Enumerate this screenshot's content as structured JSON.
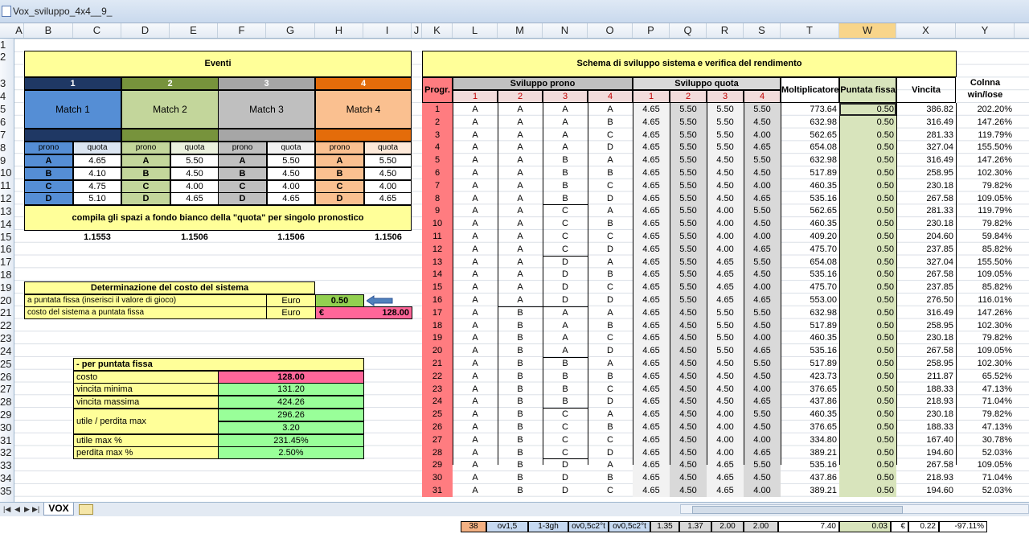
{
  "window": {
    "title": "Vox_sviluppo_4x4__9_"
  },
  "colors": {
    "navy": "#1f3864",
    "olive": "#77933c",
    "grey": "#a6a6a6",
    "orange": "#e46c0a",
    "yellow": "#ffff99",
    "green": "#92d050",
    "lightgreen": "#99ff99",
    "pink": "#ff6699",
    "salmon": "#ff7c80",
    "blue": "#558ed5",
    "teal": "#d8e4bc",
    "lilac": "#d9d9f3"
  },
  "columns": [
    "A",
    "B",
    "C",
    "D",
    "E",
    "F",
    "G",
    "H",
    "I",
    "J",
    "K",
    "L",
    "M",
    "N",
    "O",
    "P",
    "Q",
    "R",
    "S",
    "T",
    "W",
    "X",
    "Y"
  ],
  "rows": [
    "1",
    "2",
    "3",
    "4",
    "5",
    "6",
    "7",
    "8",
    "9",
    "10",
    "11",
    "12",
    "13",
    "14",
    "15",
    "16",
    "17",
    "18",
    "19",
    "20",
    "21",
    "22",
    "23",
    "24",
    "25",
    "26",
    "27",
    "28",
    "29",
    "30",
    "31",
    "32",
    "33",
    "34",
    "35"
  ],
  "eventi": {
    "title": "Eventi",
    "numbers": [
      "1",
      "2",
      "3",
      "4"
    ],
    "matches": [
      "Match 1",
      "Match 2",
      "Match 3",
      "Match 4"
    ],
    "hdr": [
      "prono",
      "quota"
    ],
    "prono": [
      "A",
      "B",
      "C",
      "D"
    ],
    "quote": [
      [
        "4.65",
        "4.10",
        "4.75",
        "5.10"
      ],
      [
        "5.50",
        "4.50",
        "4.00",
        "4.65"
      ],
      [
        "5.50",
        "4.50",
        "4.00",
        "4.65"
      ],
      [
        "5.50",
        "4.50",
        "4.00",
        "4.65"
      ]
    ],
    "note": "compila gli spazi a fondo bianco della \"quota\" per singolo pronostico",
    "factors": [
      "1.1553",
      "1.1506",
      "1.1506",
      "1.1506"
    ]
  },
  "costo": {
    "title": "Determinazione del costo del sistema",
    "row1_label": "a puntata fissa (inserisci il valore di gioco)",
    "row1_unit": "Euro",
    "row1_value": "0.50",
    "row2_label": "costo del sistema a puntata fissa",
    "row2_unit": "Euro",
    "row2_cur": "€",
    "row2_value": "128.00"
  },
  "summary": {
    "title": "- per puntata fissa",
    "rows": [
      {
        "label": "costo",
        "value": "128.00"
      },
      {
        "label": "vincita minima",
        "value": "131.20"
      },
      {
        "label": "vincita massima",
        "value": "424.26"
      },
      {
        "label": "utile / perdita  max",
        "value": "296.26",
        "value2": "3.20"
      },
      {
        "label": "utile max %",
        "value": "231.45%"
      },
      {
        "label": "perdita max %",
        "value": "2.50%"
      }
    ]
  },
  "schema": {
    "title": "Schema di sviluppo sistema e verifica del rendimento",
    "h_progr": "Progr.",
    "h_prono": "Sviluppo prono",
    "h_quota": "Sviluppo quota",
    "h_molt": "Moltiplicatore",
    "h_punt": "Puntata fissa",
    "h_vinc": "Vincita",
    "h_col1": "Colnna",
    "h_col2": "win/lose",
    "sub": [
      "1",
      "2",
      "3",
      "4"
    ],
    "rows": [
      [
        "1",
        "A",
        "A",
        "A",
        "A",
        "4.65",
        "5.50",
        "5.50",
        "5.50",
        "773.64",
        "0.50",
        "386.82",
        "202.20%"
      ],
      [
        "2",
        "A",
        "A",
        "A",
        "B",
        "4.65",
        "5.50",
        "5.50",
        "4.50",
        "632.98",
        "0.50",
        "316.49",
        "147.26%"
      ],
      [
        "3",
        "A",
        "A",
        "A",
        "C",
        "4.65",
        "5.50",
        "5.50",
        "4.00",
        "562.65",
        "0.50",
        "281.33",
        "119.79%"
      ],
      [
        "4",
        "A",
        "A",
        "A",
        "D",
        "4.65",
        "5.50",
        "5.50",
        "4.65",
        "654.08",
        "0.50",
        "327.04",
        "155.50%"
      ],
      [
        "5",
        "A",
        "A",
        "B",
        "A",
        "4.65",
        "5.50",
        "4.50",
        "5.50",
        "632.98",
        "0.50",
        "316.49",
        "147.26%"
      ],
      [
        "6",
        "A",
        "A",
        "B",
        "B",
        "4.65",
        "5.50",
        "4.50",
        "4.50",
        "517.89",
        "0.50",
        "258.95",
        "102.30%"
      ],
      [
        "7",
        "A",
        "A",
        "B",
        "C",
        "4.65",
        "5.50",
        "4.50",
        "4.00",
        "460.35",
        "0.50",
        "230.18",
        "79.82%"
      ],
      [
        "8",
        "A",
        "A",
        "B",
        "D",
        "4.65",
        "5.50",
        "4.50",
        "4.65",
        "535.16",
        "0.50",
        "267.58",
        "109.05%"
      ],
      [
        "9",
        "A",
        "A",
        "C",
        "A",
        "4.65",
        "5.50",
        "4.00",
        "5.50",
        "562.65",
        "0.50",
        "281.33",
        "119.79%"
      ],
      [
        "10",
        "A",
        "A",
        "C",
        "B",
        "4.65",
        "5.50",
        "4.00",
        "4.50",
        "460.35",
        "0.50",
        "230.18",
        "79.82%"
      ],
      [
        "11",
        "A",
        "A",
        "C",
        "C",
        "4.65",
        "5.50",
        "4.00",
        "4.00",
        "409.20",
        "0.50",
        "204.60",
        "59.84%"
      ],
      [
        "12",
        "A",
        "A",
        "C",
        "D",
        "4.65",
        "5.50",
        "4.00",
        "4.65",
        "475.70",
        "0.50",
        "237.85",
        "85.82%"
      ],
      [
        "13",
        "A",
        "A",
        "D",
        "A",
        "4.65",
        "5.50",
        "4.65",
        "5.50",
        "654.08",
        "0.50",
        "327.04",
        "155.50%"
      ],
      [
        "14",
        "A",
        "A",
        "D",
        "B",
        "4.65",
        "5.50",
        "4.65",
        "4.50",
        "535.16",
        "0.50",
        "267.58",
        "109.05%"
      ],
      [
        "15",
        "A",
        "A",
        "D",
        "C",
        "4.65",
        "5.50",
        "4.65",
        "4.00",
        "475.70",
        "0.50",
        "237.85",
        "85.82%"
      ],
      [
        "16",
        "A",
        "A",
        "D",
        "D",
        "4.65",
        "5.50",
        "4.65",
        "4.65",
        "553.00",
        "0.50",
        "276.50",
        "116.01%"
      ],
      [
        "17",
        "A",
        "B",
        "A",
        "A",
        "4.65",
        "4.50",
        "5.50",
        "5.50",
        "632.98",
        "0.50",
        "316.49",
        "147.26%"
      ],
      [
        "18",
        "A",
        "B",
        "A",
        "B",
        "4.65",
        "4.50",
        "5.50",
        "4.50",
        "517.89",
        "0.50",
        "258.95",
        "102.30%"
      ],
      [
        "19",
        "A",
        "B",
        "A",
        "C",
        "4.65",
        "4.50",
        "5.50",
        "4.00",
        "460.35",
        "0.50",
        "230.18",
        "79.82%"
      ],
      [
        "20",
        "A",
        "B",
        "A",
        "D",
        "4.65",
        "4.50",
        "5.50",
        "4.65",
        "535.16",
        "0.50",
        "267.58",
        "109.05%"
      ],
      [
        "21",
        "A",
        "B",
        "B",
        "A",
        "4.65",
        "4.50",
        "4.50",
        "5.50",
        "517.89",
        "0.50",
        "258.95",
        "102.30%"
      ],
      [
        "22",
        "A",
        "B",
        "B",
        "B",
        "4.65",
        "4.50",
        "4.50",
        "4.50",
        "423.73",
        "0.50",
        "211.87",
        "65.52%"
      ],
      [
        "23",
        "A",
        "B",
        "B",
        "C",
        "4.65",
        "4.50",
        "4.50",
        "4.00",
        "376.65",
        "0.50",
        "188.33",
        "47.13%"
      ],
      [
        "24",
        "A",
        "B",
        "B",
        "D",
        "4.65",
        "4.50",
        "4.50",
        "4.65",
        "437.86",
        "0.50",
        "218.93",
        "71.04%"
      ],
      [
        "25",
        "A",
        "B",
        "C",
        "A",
        "4.65",
        "4.50",
        "4.00",
        "5.50",
        "460.35",
        "0.50",
        "230.18",
        "79.82%"
      ],
      [
        "26",
        "A",
        "B",
        "C",
        "B",
        "4.65",
        "4.50",
        "4.00",
        "4.50",
        "376.65",
        "0.50",
        "188.33",
        "47.13%"
      ],
      [
        "27",
        "A",
        "B",
        "C",
        "C",
        "4.65",
        "4.50",
        "4.00",
        "4.00",
        "334.80",
        "0.50",
        "167.40",
        "30.78%"
      ],
      [
        "28",
        "A",
        "B",
        "C",
        "D",
        "4.65",
        "4.50",
        "4.00",
        "4.65",
        "389.21",
        "0.50",
        "194.60",
        "52.03%"
      ],
      [
        "29",
        "A",
        "B",
        "D",
        "A",
        "4.65",
        "4.50",
        "4.65",
        "5.50",
        "535.16",
        "0.50",
        "267.58",
        "109.05%"
      ],
      [
        "30",
        "A",
        "B",
        "D",
        "B",
        "4.65",
        "4.50",
        "4.65",
        "4.50",
        "437.86",
        "0.50",
        "218.93",
        "71.04%"
      ],
      [
        "31",
        "A",
        "B",
        "D",
        "C",
        "4.65",
        "4.50",
        "4.65",
        "4.00",
        "389.21",
        "0.50",
        "194.60",
        "52.03%"
      ]
    ]
  },
  "bottom": {
    "cells": [
      "38",
      "ov1,5",
      "1-3gh",
      "ov0,5c2°t",
      "ov0,5c2°t",
      "1.35",
      "1.37",
      "2.00",
      "2.00",
      "7.40",
      "0.03",
      "€",
      "0.22",
      "-97.11%"
    ]
  },
  "tabs": {
    "sheet": "VOX"
  }
}
